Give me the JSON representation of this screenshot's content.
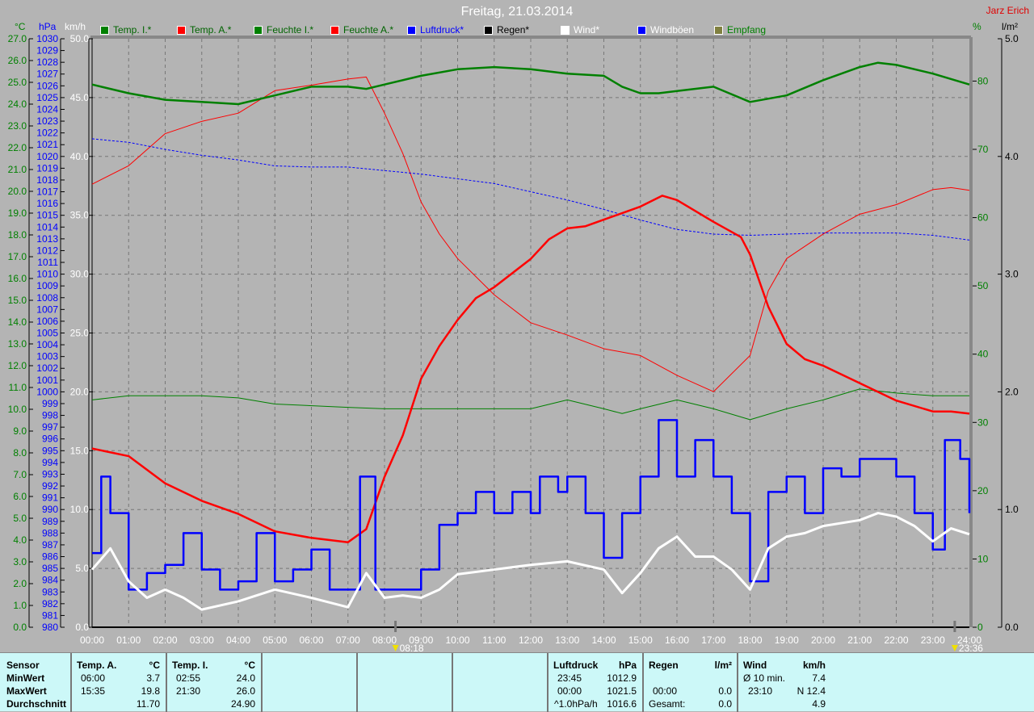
{
  "header": {
    "title": "Freitag, 21.03.2014",
    "author": "Jarz Erich"
  },
  "units": {
    "temp": "°C",
    "pressure": "hPa",
    "wind": "km/h",
    "humidity": "%",
    "rain": "l/m²"
  },
  "legend": [
    {
      "label": "Temp. I.*",
      "swatch": "#008000",
      "text_color": "#006400"
    },
    {
      "label": "Temp. A.*",
      "swatch": "#ff0000",
      "text_color": "#006400"
    },
    {
      "label": "Feuchte I.*",
      "swatch": "#008000",
      "text_color": "#006400"
    },
    {
      "label": "Feuchte A.*",
      "swatch": "#ff0000",
      "text_color": "#006400"
    },
    {
      "label": "Luftdruck*",
      "swatch": "#0000ff",
      "text_color": "#0000ff"
    },
    {
      "label": "Regen*",
      "swatch": "#000000",
      "text_color": "#000000"
    },
    {
      "label": "Wind*",
      "swatch": "#ffffff",
      "text_color": "#ffffff"
    },
    {
      "label": "Windböen",
      "swatch": "#0000ff",
      "text_color": "#ffffff"
    },
    {
      "label": "Empfang",
      "swatch": "#808040",
      "text_color": "#008000"
    }
  ],
  "markers": [
    {
      "time": "08:18",
      "hour": 8.3
    },
    {
      "time": "23:36",
      "hour": 23.6
    }
  ],
  "chart_data": {
    "type": "line",
    "title": "Freitag, 21.03.2014",
    "x_ticks": [
      "00:00",
      "01:00",
      "02:00",
      "03:00",
      "04:00",
      "05:00",
      "06:00",
      "07:00",
      "08:00",
      "09:00",
      "10:00",
      "11:00",
      "12:00",
      "13:00",
      "14:00",
      "15:00",
      "16:00",
      "17:00",
      "18:00",
      "19:00",
      "20:00",
      "21:00",
      "22:00",
      "23:00",
      "24:00"
    ],
    "xlim": [
      0,
      24
    ],
    "axes": {
      "temp": {
        "range": [
          0,
          27
        ],
        "step": 1,
        "decimals": 1,
        "color": "#008000"
      },
      "pressure": {
        "range": [
          980,
          1030
        ],
        "step": 1,
        "decimals": 0,
        "color": "#0000ff"
      },
      "wind": {
        "range": [
          0,
          50
        ],
        "step": 5,
        "decimals": 1,
        "color": "#ffffff"
      },
      "humidity": {
        "range": [
          0,
          86.2
        ],
        "ticks": [
          0,
          10,
          20,
          30,
          40,
          50,
          60,
          70,
          80
        ],
        "color": "#008000"
      },
      "rain": {
        "range": [
          0,
          5
        ],
        "step": 1,
        "decimals": 1,
        "color": "#000000"
      }
    },
    "series": [
      {
        "name": "Feuchte I.",
        "axis": "humidity",
        "color": "#008000",
        "width": 1,
        "x": [
          0,
          1,
          3,
          4,
          5,
          7,
          8,
          12,
          13,
          14,
          14.5,
          15,
          16,
          17,
          18,
          19,
          20,
          21,
          22,
          23,
          24
        ],
        "y": [
          33.3,
          33.9,
          33.9,
          33.6,
          32.7,
          32.2,
          32.0,
          32.0,
          33.3,
          32.0,
          31.3,
          32.0,
          33.3,
          32.0,
          30.4,
          32.0,
          33.3,
          34.9,
          34.3,
          33.9,
          33.9
        ]
      },
      {
        "name": "Feuchte A.",
        "axis": "humidity",
        "color": "#ff0000",
        "width": 1,
        "x": [
          0,
          1,
          2,
          3,
          4,
          5,
          6,
          7,
          7.5,
          8,
          8.5,
          9,
          9.5,
          10,
          11,
          12,
          13,
          14,
          15,
          16,
          17,
          18,
          18.5,
          19,
          20,
          21,
          22,
          23,
          23.5,
          24
        ],
        "y": [
          64.9,
          67.6,
          72.3,
          74.1,
          75.3,
          78.6,
          79.4,
          80.3,
          80.6,
          75.3,
          69.4,
          62.3,
          57.6,
          54.0,
          48.7,
          44.6,
          42.8,
          40.8,
          39.8,
          36.9,
          34.5,
          39.8,
          49.3,
          54.0,
          57.6,
          60.5,
          61.9,
          64.1,
          64.4,
          64.0
        ]
      },
      {
        "name": "Luftdruck",
        "axis": "pressure",
        "color": "#0000ff",
        "width": 1,
        "dashed": true,
        "x": [
          0,
          1,
          2,
          3,
          4,
          5,
          6,
          7,
          8,
          9,
          10,
          11,
          12,
          13,
          14,
          15,
          16,
          17,
          18,
          19,
          20,
          21,
          22,
          23,
          24
        ],
        "y": [
          1021.5,
          1021.2,
          1020.6,
          1020.1,
          1019.7,
          1019.2,
          1019.1,
          1019.1,
          1018.8,
          1018.5,
          1018.1,
          1017.7,
          1017.0,
          1016.3,
          1015.5,
          1014.6,
          1013.8,
          1013.4,
          1013.3,
          1013.4,
          1013.5,
          1013.5,
          1013.5,
          1013.3,
          1012.9
        ]
      },
      {
        "name": "Temp. I.",
        "axis": "temp",
        "color": "#008000",
        "width": 2.5,
        "x": [
          0,
          1,
          2,
          3,
          4,
          5,
          6,
          7,
          7.5,
          8,
          9,
          10,
          11,
          12,
          13,
          14,
          14.5,
          15,
          15.5,
          16,
          17,
          18,
          19,
          20,
          21,
          21.5,
          22,
          23,
          24
        ],
        "y": [
          24.9,
          24.5,
          24.2,
          24.1,
          24.0,
          24.4,
          24.8,
          24.8,
          24.7,
          24.9,
          25.3,
          25.6,
          25.7,
          25.6,
          25.4,
          25.3,
          24.8,
          24.5,
          24.5,
          24.6,
          24.8,
          24.1,
          24.4,
          25.1,
          25.7,
          25.9,
          25.8,
          25.4,
          24.9
        ]
      },
      {
        "name": "Temp. A.",
        "axis": "temp",
        "color": "#ff0000",
        "width": 2.5,
        "x": [
          0,
          1,
          2,
          3,
          4,
          5,
          6,
          7,
          7.5,
          8,
          8.5,
          9,
          9.5,
          10,
          10.5,
          11,
          12,
          12.5,
          13,
          13.5,
          14,
          15,
          15.6,
          16,
          17,
          17.75,
          18,
          18.5,
          19,
          19.5,
          20,
          21,
          22,
          23,
          23.5,
          24
        ],
        "y": [
          8.2,
          7.85,
          6.6,
          5.8,
          5.2,
          4.4,
          4.1,
          3.9,
          4.5,
          6.9,
          8.8,
          11.4,
          12.9,
          14.1,
          15.1,
          15.6,
          16.9,
          17.8,
          18.3,
          18.4,
          18.7,
          19.3,
          19.8,
          19.6,
          18.6,
          17.9,
          17.1,
          14.7,
          13.0,
          12.3,
          12.0,
          11.2,
          10.4,
          9.9,
          9.9,
          9.8
        ]
      },
      {
        "name": "Windböen",
        "axis": "wind",
        "color": "#0000ff",
        "width": 2.5,
        "step": true,
        "x": [
          0,
          0.25,
          0.5,
          1,
          1.5,
          2,
          2.5,
          3,
          3.5,
          4,
          4.5,
          5,
          5.5,
          6,
          6.5,
          7,
          7.33,
          7.75,
          8.5,
          9,
          9.5,
          10,
          10.5,
          11,
          11.5,
          12,
          12.25,
          12.75,
          13,
          13.5,
          14,
          14.5,
          15,
          15.5,
          16,
          16.5,
          17,
          17.5,
          18,
          18.5,
          19,
          19.5,
          20,
          20.5,
          21,
          21.5,
          22,
          22.5,
          23,
          23.33,
          23.75,
          24
        ],
        "y": [
          6.3,
          12.8,
          9.7,
          3.2,
          4.6,
          5.3,
          8.0,
          4.9,
          3.2,
          3.9,
          8.0,
          3.9,
          4.9,
          6.6,
          3.2,
          3.2,
          12.8,
          3.2,
          3.2,
          4.9,
          8.7,
          9.7,
          11.5,
          9.7,
          11.5,
          9.7,
          12.8,
          11.5,
          12.8,
          9.7,
          5.9,
          9.7,
          12.8,
          17.6,
          12.8,
          15.9,
          12.8,
          9.7,
          3.9,
          11.5,
          12.8,
          9.7,
          13.5,
          12.8,
          14.3,
          14.3,
          12.8,
          9.7,
          6.6,
          15.9,
          14.3,
          9.7
        ]
      },
      {
        "name": "Wind",
        "axis": "wind",
        "color": "#ffffff",
        "width": 3,
        "x": [
          0,
          0.5,
          1,
          1.5,
          2,
          2.5,
          3,
          4,
          5,
          6,
          7,
          7.5,
          8,
          8.5,
          9,
          9.5,
          10,
          11,
          12,
          13,
          14,
          14.5,
          15,
          15.5,
          16,
          16.5,
          17,
          17.5,
          18,
          18.5,
          19,
          19.5,
          20,
          21,
          21.5,
          22,
          22.5,
          23,
          23.5,
          24
        ],
        "y": [
          4.9,
          6.7,
          3.9,
          2.5,
          3.2,
          2.5,
          1.5,
          2.2,
          3.2,
          2.5,
          1.7,
          4.6,
          2.5,
          2.7,
          2.5,
          3.2,
          4.5,
          4.9,
          5.3,
          5.6,
          4.9,
          2.9,
          4.6,
          6.7,
          7.7,
          6.0,
          6.0,
          4.9,
          3.2,
          6.7,
          7.7,
          8.0,
          8.6,
          9.1,
          9.7,
          9.4,
          8.6,
          7.3,
          8.4,
          7.9
        ]
      }
    ]
  },
  "table": {
    "temp_a": {
      "sensor": "Sensor",
      "min": "MinWert",
      "max": "MaxWert",
      "avg": "Durchschnitt",
      "head": "Temp. A.",
      "unit": "°C",
      "min_time": "06:00",
      "min_val": "3.7",
      "max_time": "15:35",
      "max_val": "19.8",
      "avg_val": "11.70"
    },
    "temp_i": {
      "head": "Temp. I.",
      "unit": "°C",
      "min_time": "02:55",
      "min_val": "24.0",
      "max_time": "21:30",
      "max_val": "26.0",
      "avg_val": "24.90"
    },
    "pressure": {
      "head": "Luftdruck",
      "unit": "hPa",
      "r1a": "23:45",
      "r1b": "1012.9",
      "r2a": "00:00",
      "r2b": "1021.5",
      "r3a": "^1.0hPa/h",
      "r3b": "1016.6"
    },
    "rain": {
      "head": "Regen",
      "unit": "l/m²",
      "r2a": "00:00",
      "r2b": "0.0",
      "r3a": "Gesamt:",
      "r3b": "0.0"
    },
    "wind": {
      "head": "Wind",
      "unit": "km/h",
      "r1a": "Ø 10 min.",
      "r1b": "7.4",
      "r2a": "23:10",
      "r2b": "N 12.4",
      "r3b": "4.9"
    }
  }
}
